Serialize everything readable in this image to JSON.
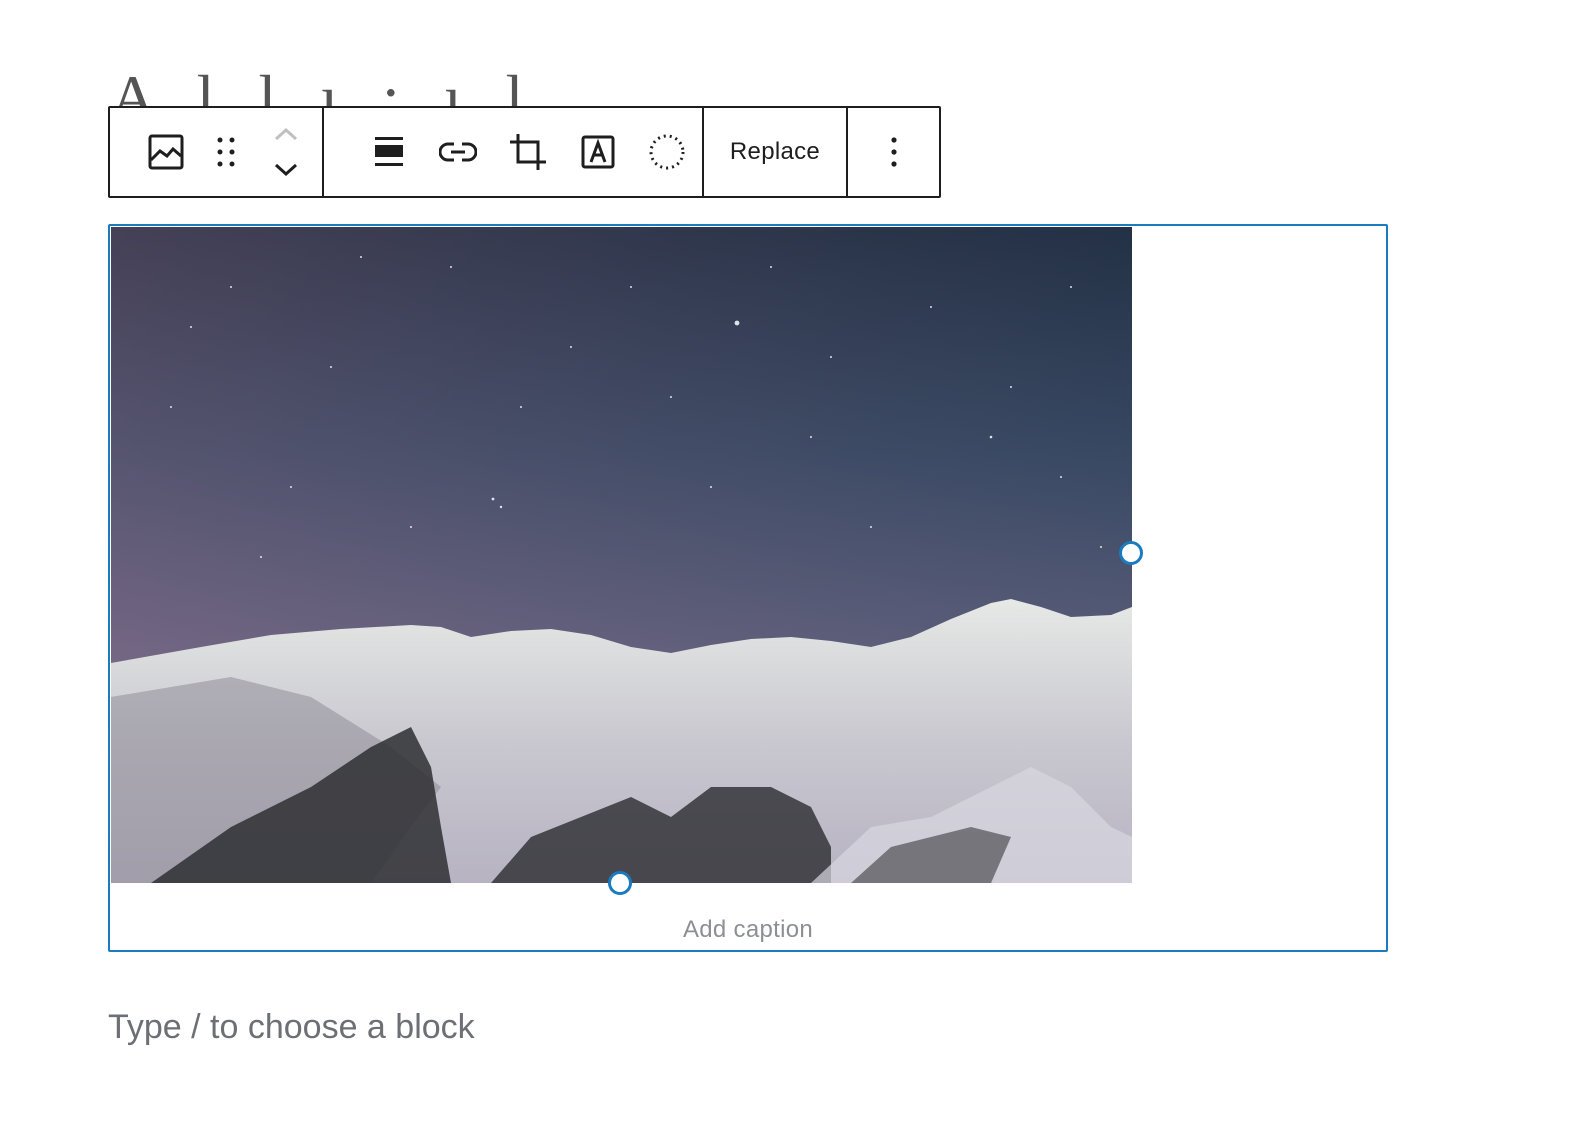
{
  "post": {
    "title_fragment": "A l l ı ; ı l"
  },
  "toolbar": {
    "image_icon": "image-icon",
    "drag_icon": "drag-handle-icon",
    "move_up_icon": "chevron-up-icon",
    "move_down_icon": "chevron-down-icon",
    "align_icon": "align-icon",
    "link_icon": "link-icon",
    "crop_icon": "crop-icon",
    "text_overlay_icon": "text-overlay-icon",
    "duotone_icon": "duotone-icon",
    "replace_label": "Replace",
    "more_icon": "more-vertical-icon"
  },
  "image_block": {
    "image_alt": "Snowy mountains under a starry night sky",
    "caption_placeholder": "Add caption",
    "accent_color": "#1a7bbf"
  },
  "appender": {
    "placeholder": "Type / to choose a block"
  }
}
